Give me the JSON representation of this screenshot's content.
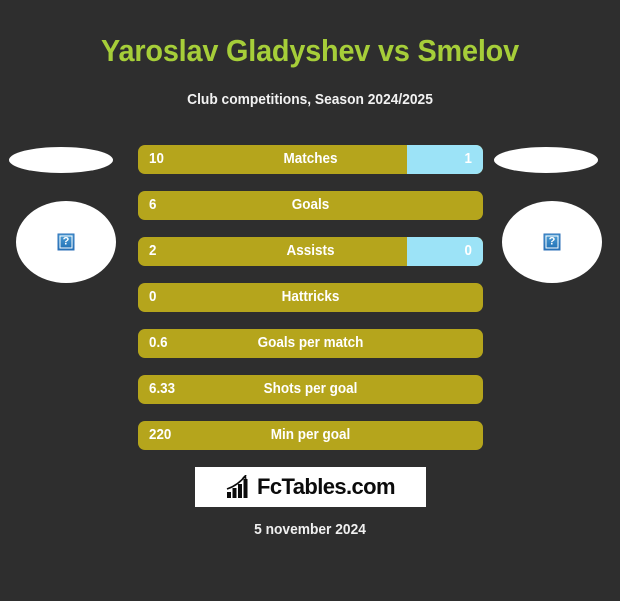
{
  "page": {
    "background_color": "#2e2e2e",
    "title": "Yaroslav Gladyshev vs Smelov",
    "title_color": "#a6ce39",
    "subtitle": "Club competitions, Season 2024/2025",
    "date": "5 november 2024"
  },
  "players": {
    "left": {
      "photo_alt": "?",
      "photo_status": "broken-image"
    },
    "right": {
      "photo_alt": "?",
      "photo_status": "broken-image"
    }
  },
  "colors": {
    "bar_primary": "#b5a51c",
    "bar_secondary": "#9ce3f7",
    "text": "#ffffff",
    "accent": "#a6ce39"
  },
  "chart_data": {
    "type": "bar",
    "title": "Yaroslav Gladyshev vs Smelov",
    "subtitle": "Club competitions, Season 2024/2025",
    "categories": [
      "Matches",
      "Goals",
      "Assists",
      "Hattricks",
      "Goals per match",
      "Shots per goal",
      "Min per goal"
    ],
    "series": [
      {
        "name": "Yaroslav Gladyshev",
        "color": "#b5a51c",
        "values": [
          "10",
          "6",
          "2",
          "0",
          "0.6",
          "6.33",
          "220"
        ]
      },
      {
        "name": "Smelov",
        "color": "#9ce3f7",
        "values": [
          "1",
          "",
          "0",
          "",
          "",
          "",
          ""
        ]
      }
    ],
    "rows": [
      {
        "left": "10",
        "label": "Matches",
        "right": "1",
        "right_pct": 22
      },
      {
        "left": "6",
        "label": "Goals",
        "right": "",
        "right_pct": 0
      },
      {
        "left": "2",
        "label": "Assists",
        "right": "0",
        "right_pct": 22
      },
      {
        "left": "0",
        "label": "Hattricks",
        "right": "",
        "right_pct": 0
      },
      {
        "left": "0.6",
        "label": "Goals per match",
        "right": "",
        "right_pct": 0
      },
      {
        "left": "6.33",
        "label": "Shots per goal",
        "right": "",
        "right_pct": 0
      },
      {
        "left": "220",
        "label": "Min per goal",
        "right": "",
        "right_pct": 0
      }
    ]
  },
  "footer": {
    "logo_text": "FcTables.com",
    "logo_icon": "bar-chart-growth-icon"
  }
}
